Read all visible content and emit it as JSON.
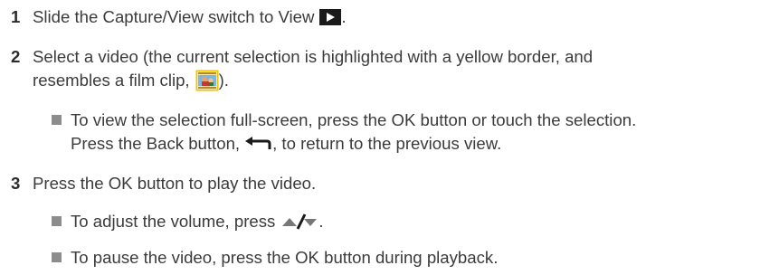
{
  "steps": [
    {
      "number": "1",
      "text_before": "Slide the Capture/View switch to View",
      "icon": "play-icon",
      "text_after": "."
    },
    {
      "number": "2",
      "line1": "Select a video (the current selection is highlighted with a yellow border, and",
      "line2_before": "resembles a film clip,",
      "icon": "film-clip-thumbnail-icon",
      "line2_after": ").",
      "bullets": [
        {
          "line1": "To view the selection full-screen, press the OK button or touch the selection.",
          "line2_before": "Press the Back button,",
          "icon": "back-arrow-icon",
          "line2_after": ", to return to the previous view."
        }
      ]
    },
    {
      "number": "3",
      "text": "Press the OK button to play the video.",
      "bullets": [
        {
          "text_before": "To adjust the volume, press",
          "icon": "volume-up-down-icon",
          "text_after": "."
        },
        {
          "text": "To pause the video, press the OK button during playback."
        }
      ]
    }
  ],
  "colors": {
    "text": "#3b3b3b",
    "bullet_square": "#8c8c8c",
    "icon_fill": "#1a1a1a",
    "thumbnail_border": "#f2c200"
  }
}
